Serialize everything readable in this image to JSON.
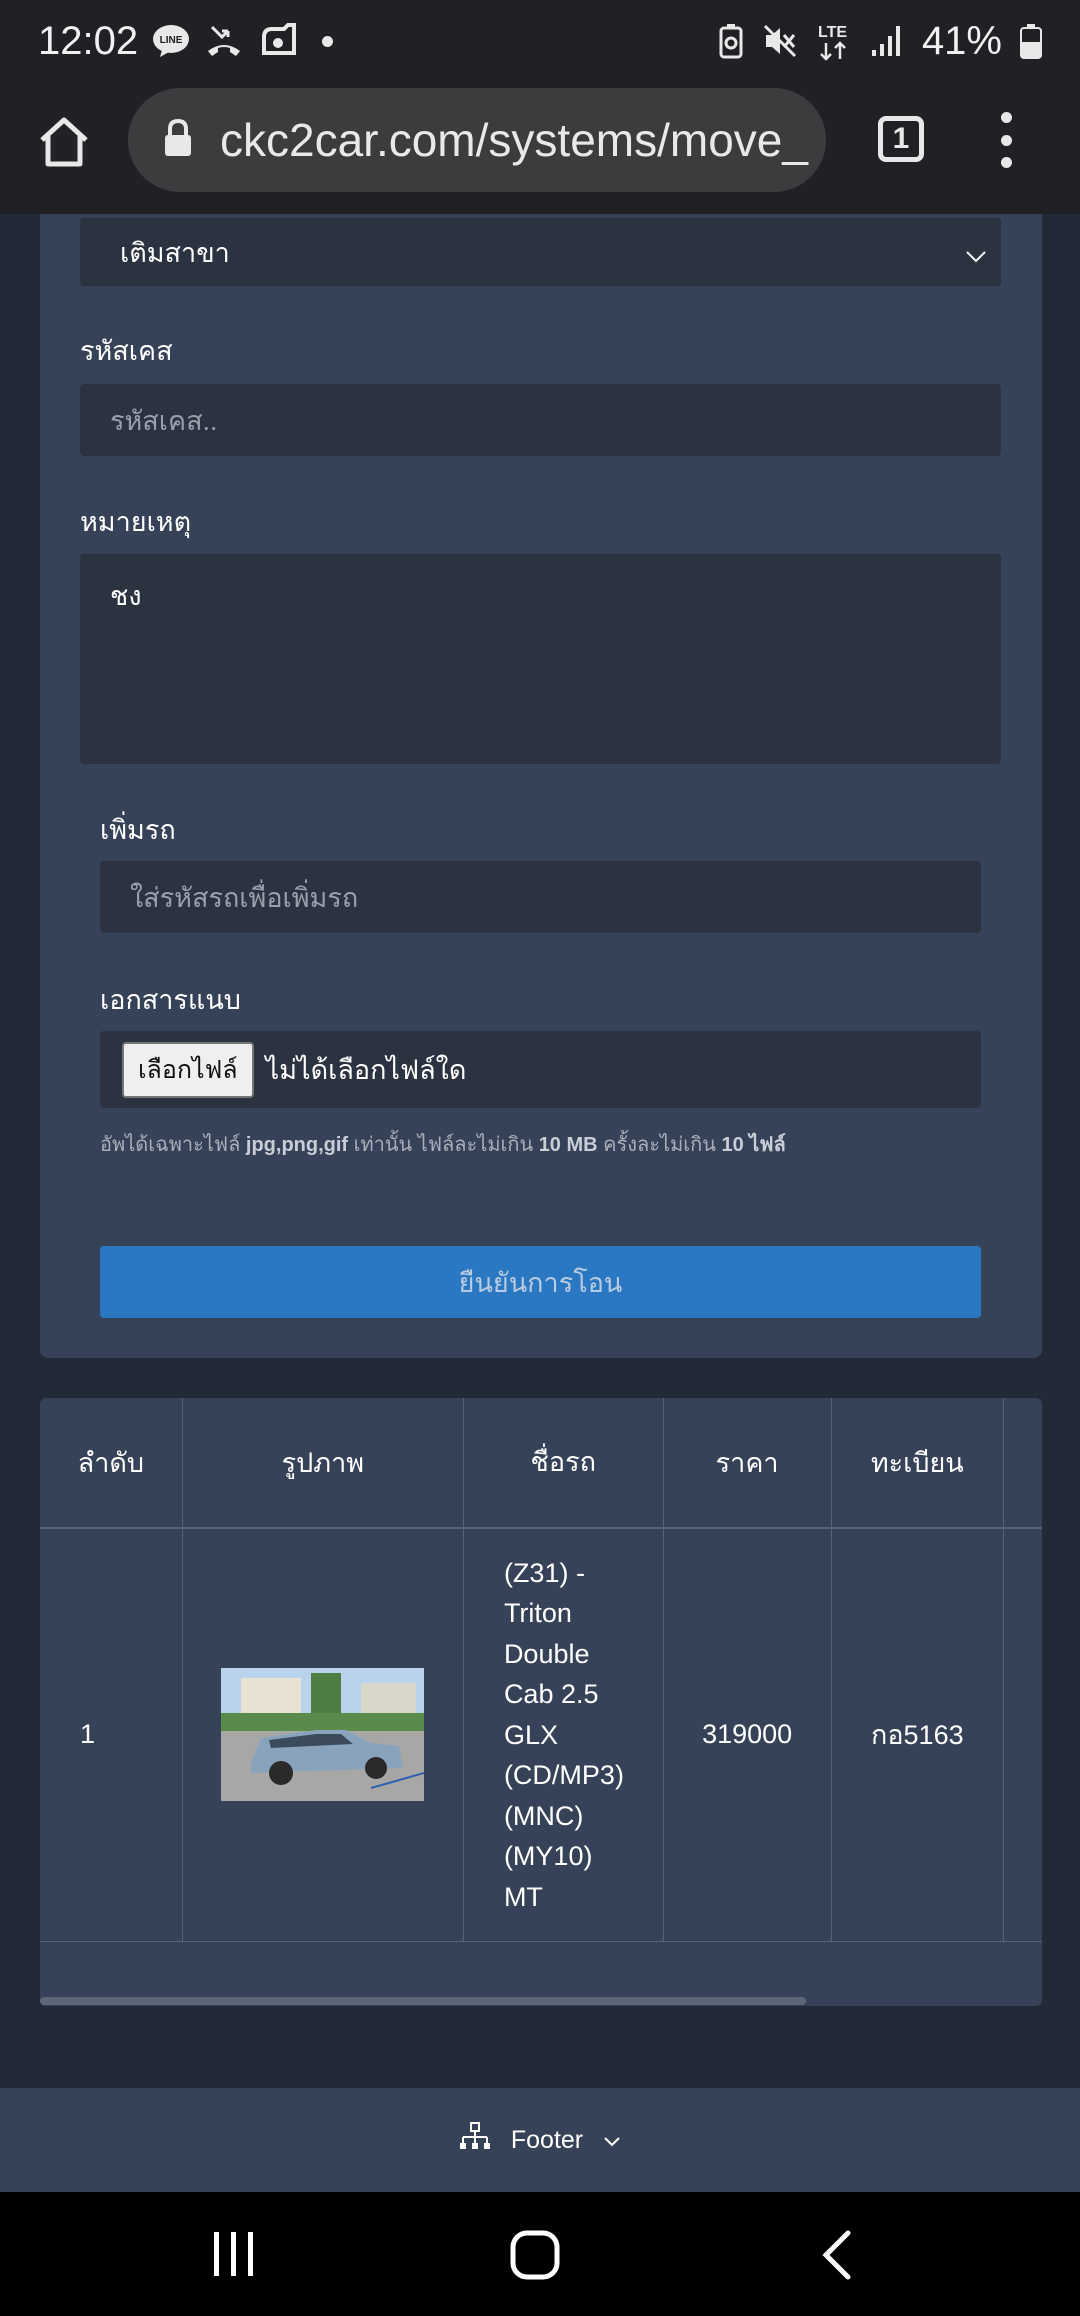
{
  "status_bar": {
    "time": "12:02",
    "battery": "41%",
    "network": "LTE"
  },
  "browser": {
    "url": "ckc2car.com/systems/move_",
    "tab_count": "1"
  },
  "form": {
    "branch_select_value": "เติมสาขา",
    "case_code_label": "รหัสเคส",
    "case_code_placeholder": "รหัสเคส..",
    "note_label": "หมายเหตุ",
    "note_value": "ชง",
    "add_car_label": "เพิ่มรถ",
    "add_car_placeholder": "ใส่รหัสรถเพื่อเพิ่มรถ",
    "attachment_label": "เอกสารแนบ",
    "file_button_label": "เลือกไฟล์",
    "file_status": "ไม่ได้เลือกไฟล์ใด",
    "hint_prefix": "อัพได้เฉพาะไฟล์ ",
    "hint_types": "jpg,png,gif",
    "hint_mid1": " เท่านั้น ไฟล์ละไม่เกิน ",
    "hint_size": "10 MB",
    "hint_mid2": " ครั้งละไม่เกิน ",
    "hint_count": "10 ไฟล์",
    "confirm_button": "ยืนยันการโอน"
  },
  "table": {
    "headers": [
      "ลำดับ",
      "รูปภาพ",
      "ชื่อรถ",
      "ราคา",
      "ทะเบียน"
    ],
    "rows": [
      {
        "no": "1",
        "name_lines": [
          "(Z31) -",
          "Triton",
          "Double",
          "Cab 2.5",
          "GLX",
          "(CD/MP3)",
          "(MNC)",
          "(MY10)",
          "MT"
        ],
        "price": "319000",
        "plate": "กอ5163"
      }
    ]
  },
  "footer": {
    "label": "Footer"
  },
  "icons": {
    "home": "home-icon",
    "lock": "lock-icon",
    "menu": "more-vert-icon",
    "footer": "sitemap-icon",
    "chevron": "chevron-down-icon"
  },
  "colors": {
    "page_bg": "#222a38",
    "card_bg": "#364257",
    "input_bg": "#2b3240",
    "primary_button": "#2a78c2"
  }
}
